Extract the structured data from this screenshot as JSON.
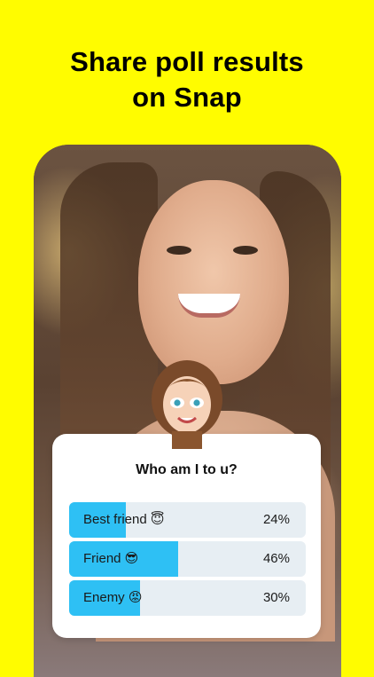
{
  "headline": {
    "line1": "Share poll results",
    "line2": "on Snap"
  },
  "poll": {
    "question": "Who am I to u?",
    "options": [
      {
        "label": "Best friend 😇",
        "percent_text": "24%",
        "percent": 24
      },
      {
        "label": "Friend 😎",
        "percent_text": "46%",
        "percent": 46
      },
      {
        "label": "Enemy 😡",
        "percent_text": "30%",
        "percent": 30
      }
    ]
  },
  "colors": {
    "background": "#FFFC00",
    "bar_fill": "#2ec0f4",
    "bar_track": "#e7eef3"
  },
  "icons": {
    "avatar": "bitmoji-avatar-icon"
  }
}
